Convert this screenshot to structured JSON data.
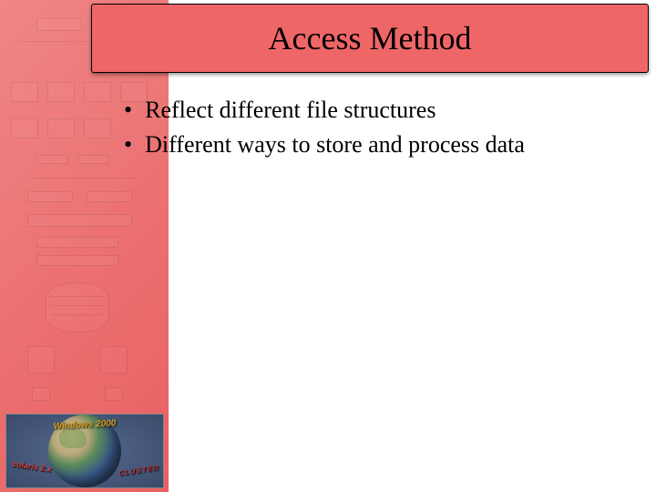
{
  "title": "Access Method",
  "bullets": [
    "Reflect different file structures",
    "Different ways to store and process data"
  ],
  "logo": {
    "top_text": "Windows 2000",
    "left_text": "solaris 2.x",
    "right_text": "CLUSTER"
  }
}
